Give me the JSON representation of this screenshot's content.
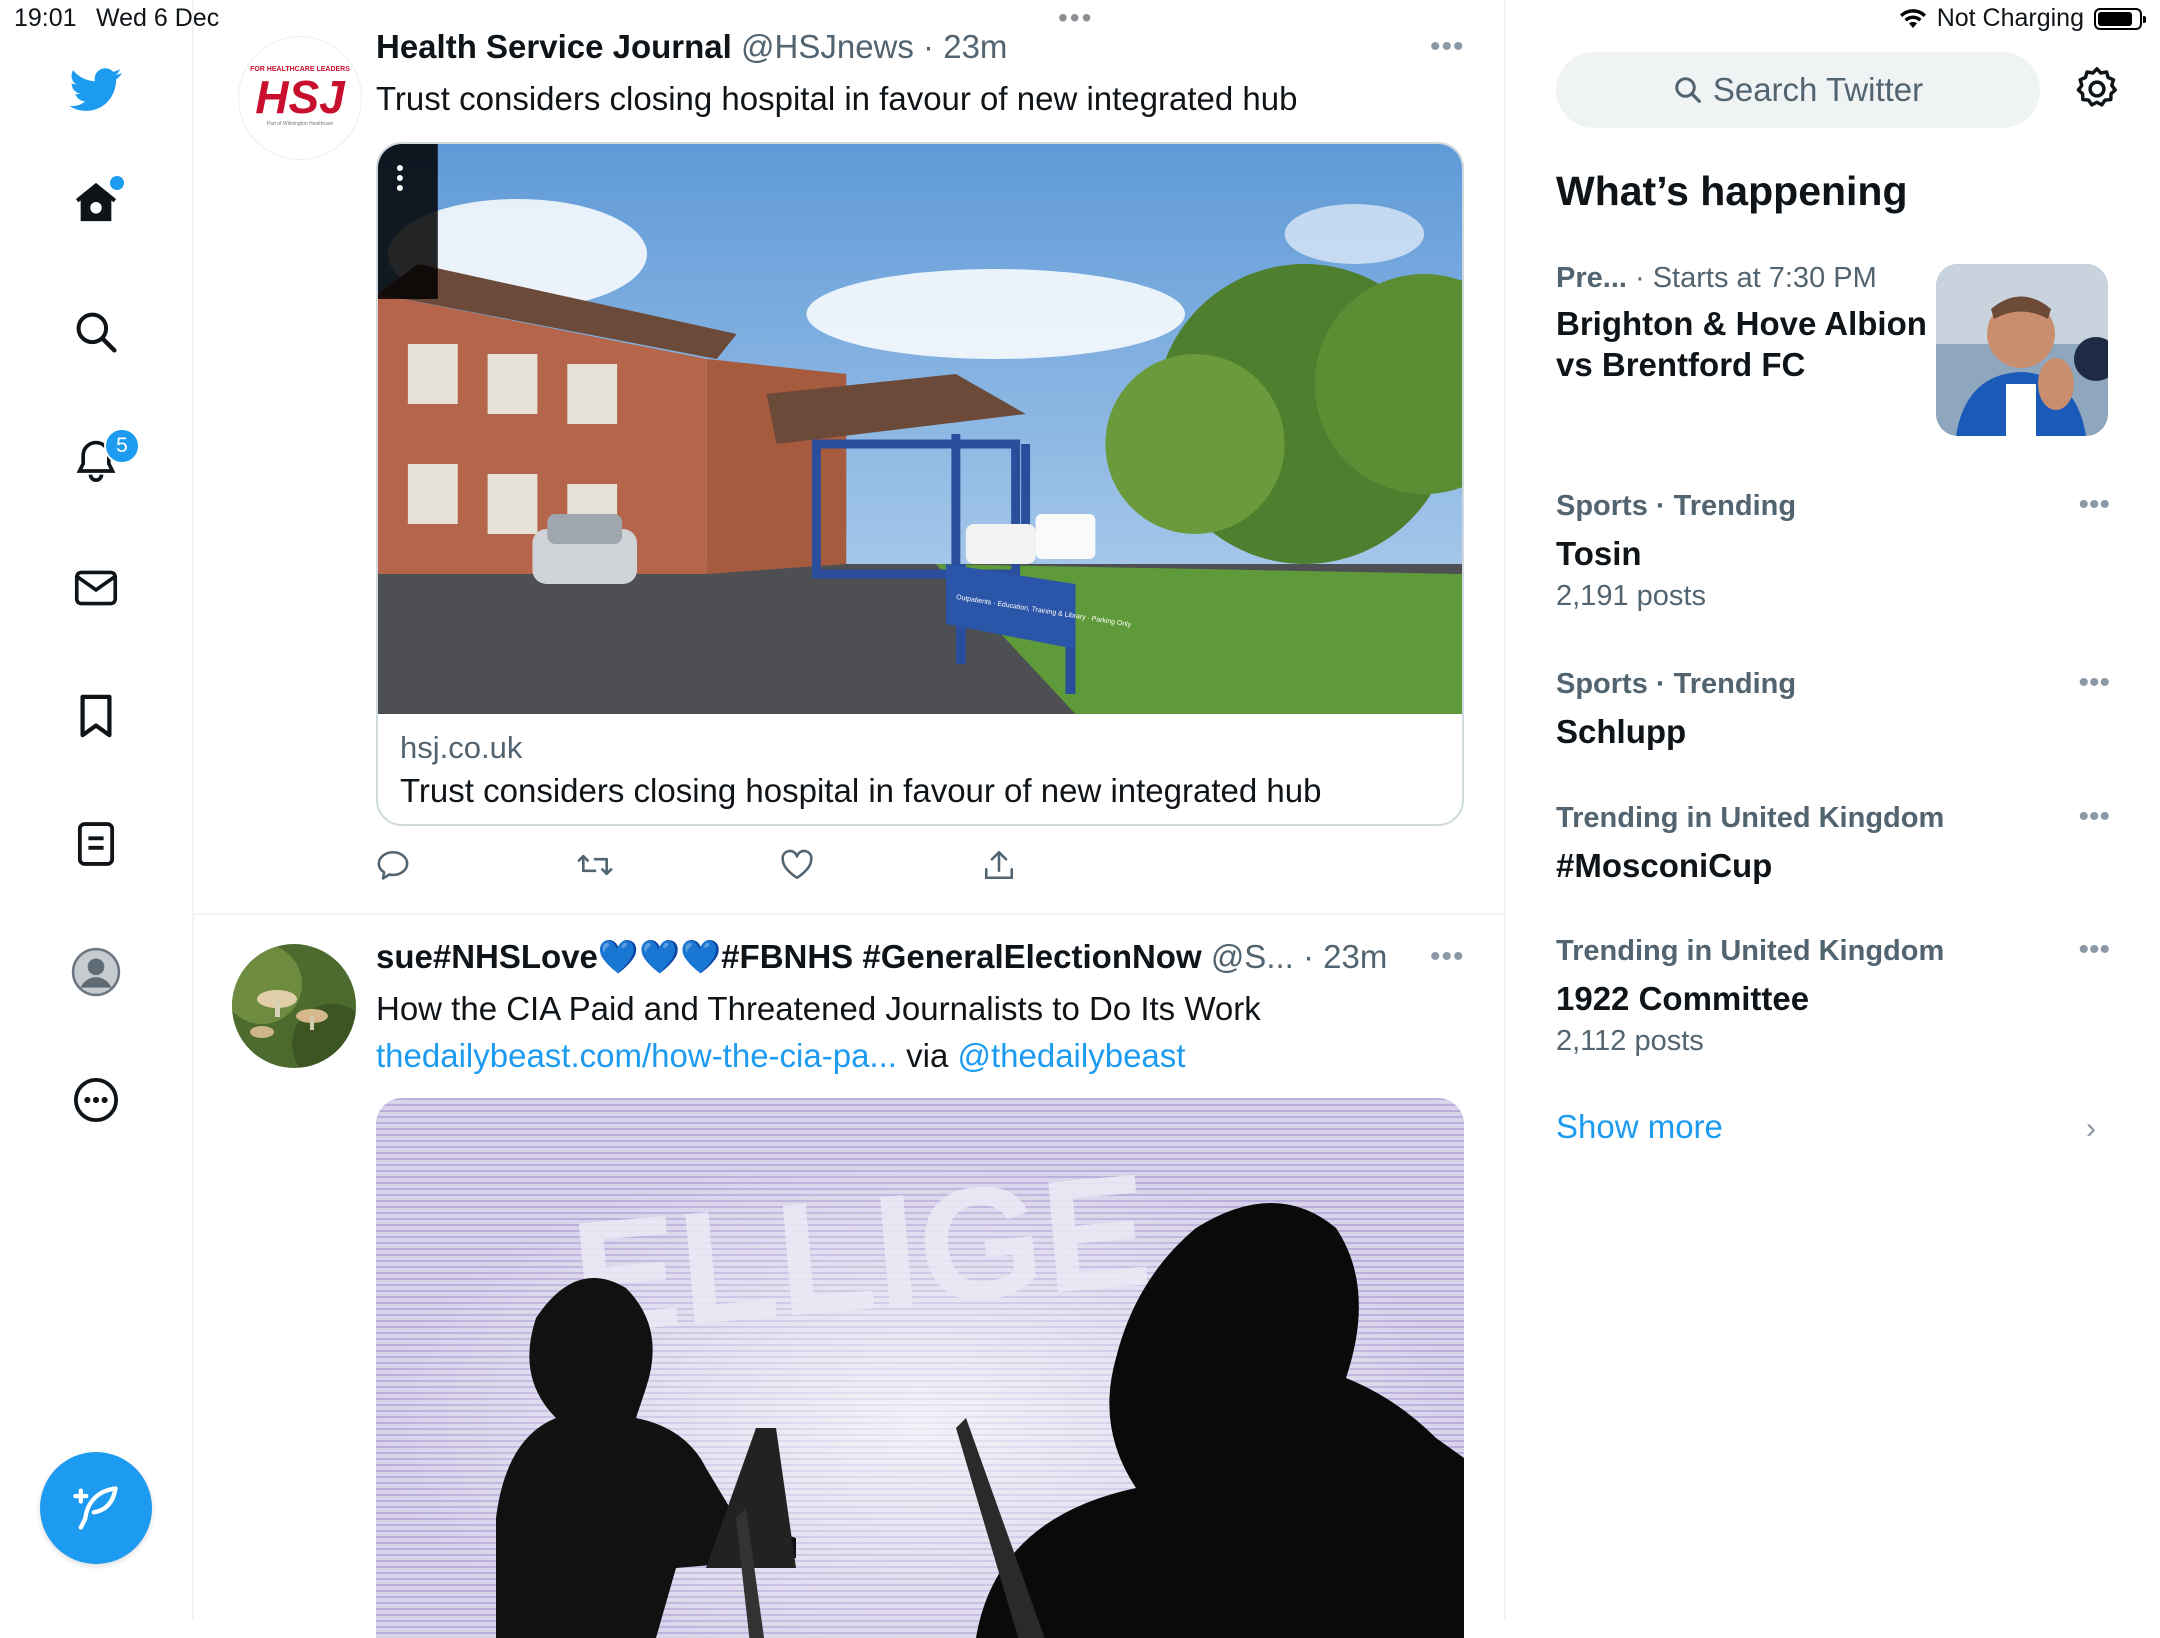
{
  "status_bar": {
    "time": "19:01",
    "date": "Wed 6 Dec",
    "charging": "Not Charging",
    "battery_level": 0.85
  },
  "nav": {
    "items": [
      {
        "name": "twitter-logo-icon"
      },
      {
        "name": "home-icon"
      },
      {
        "name": "explore-search-icon"
      },
      {
        "name": "notifications-bell-icon"
      },
      {
        "name": "messages-mail-icon"
      },
      {
        "name": "bookmarks-icon"
      },
      {
        "name": "lists-icon"
      },
      {
        "name": "profile-avatar-icon"
      },
      {
        "name": "more-options-icon"
      }
    ],
    "notifications_count": "5",
    "compose_icon": "compose-feather-icon"
  },
  "colors": {
    "accent": "#1d9bf0",
    "text": "#0f1419",
    "secondary": "#536471",
    "border": "#cfd9de"
  },
  "tweets": [
    {
      "name": "Health Service Journal",
      "handle": "@HSJnews",
      "sep": " · ",
      "time": "23m",
      "avatar_text": "HSJ",
      "avatar_top": "FOR HEALTHCARE LEADERS",
      "avatar_bottom": "Part of Wilmington Healthcare",
      "text": "Trust considers closing hospital in favour of new integrated hub",
      "card": {
        "domain": "hsj.co.uk",
        "title": "Trust considers closing hospital in favour of new integrated hub",
        "sign_text": "Outpatients · Education, Training & Library · Parking Only"
      }
    },
    {
      "name": "sue#NHSLove💙💙💙#FBNHS #GeneralElectionNow",
      "handle": "@S...",
      "sep": " · ",
      "time": "23m",
      "text": "How the CIA Paid and Threatened Journalists to Do Its Work",
      "link": "thedailybeast.com/how-the-cia-pa...",
      "via": " via ",
      "mention": "@thedailybeast",
      "media_text": "ELLIGE"
    }
  ],
  "right": {
    "search_placeholder": "Search Twitter",
    "whats_happening": "What’s happening",
    "trends": [
      {
        "context": "Pre...",
        "context_extra": " · Starts at 7:30 PM",
        "title": "Brighton & Hove Albion vs Brentford FC"
      },
      {
        "context": "Sports · Trending",
        "title": "Tosin",
        "count": "2,191 posts"
      },
      {
        "context": "Sports · Trending",
        "title": "Schlupp"
      },
      {
        "context": "Trending in United Kingdom",
        "title": "#MosconiCup"
      },
      {
        "context": "Trending in United Kingdom",
        "title": "1922 Committee",
        "count": "2,112 posts"
      }
    ],
    "show_more": "Show more"
  }
}
